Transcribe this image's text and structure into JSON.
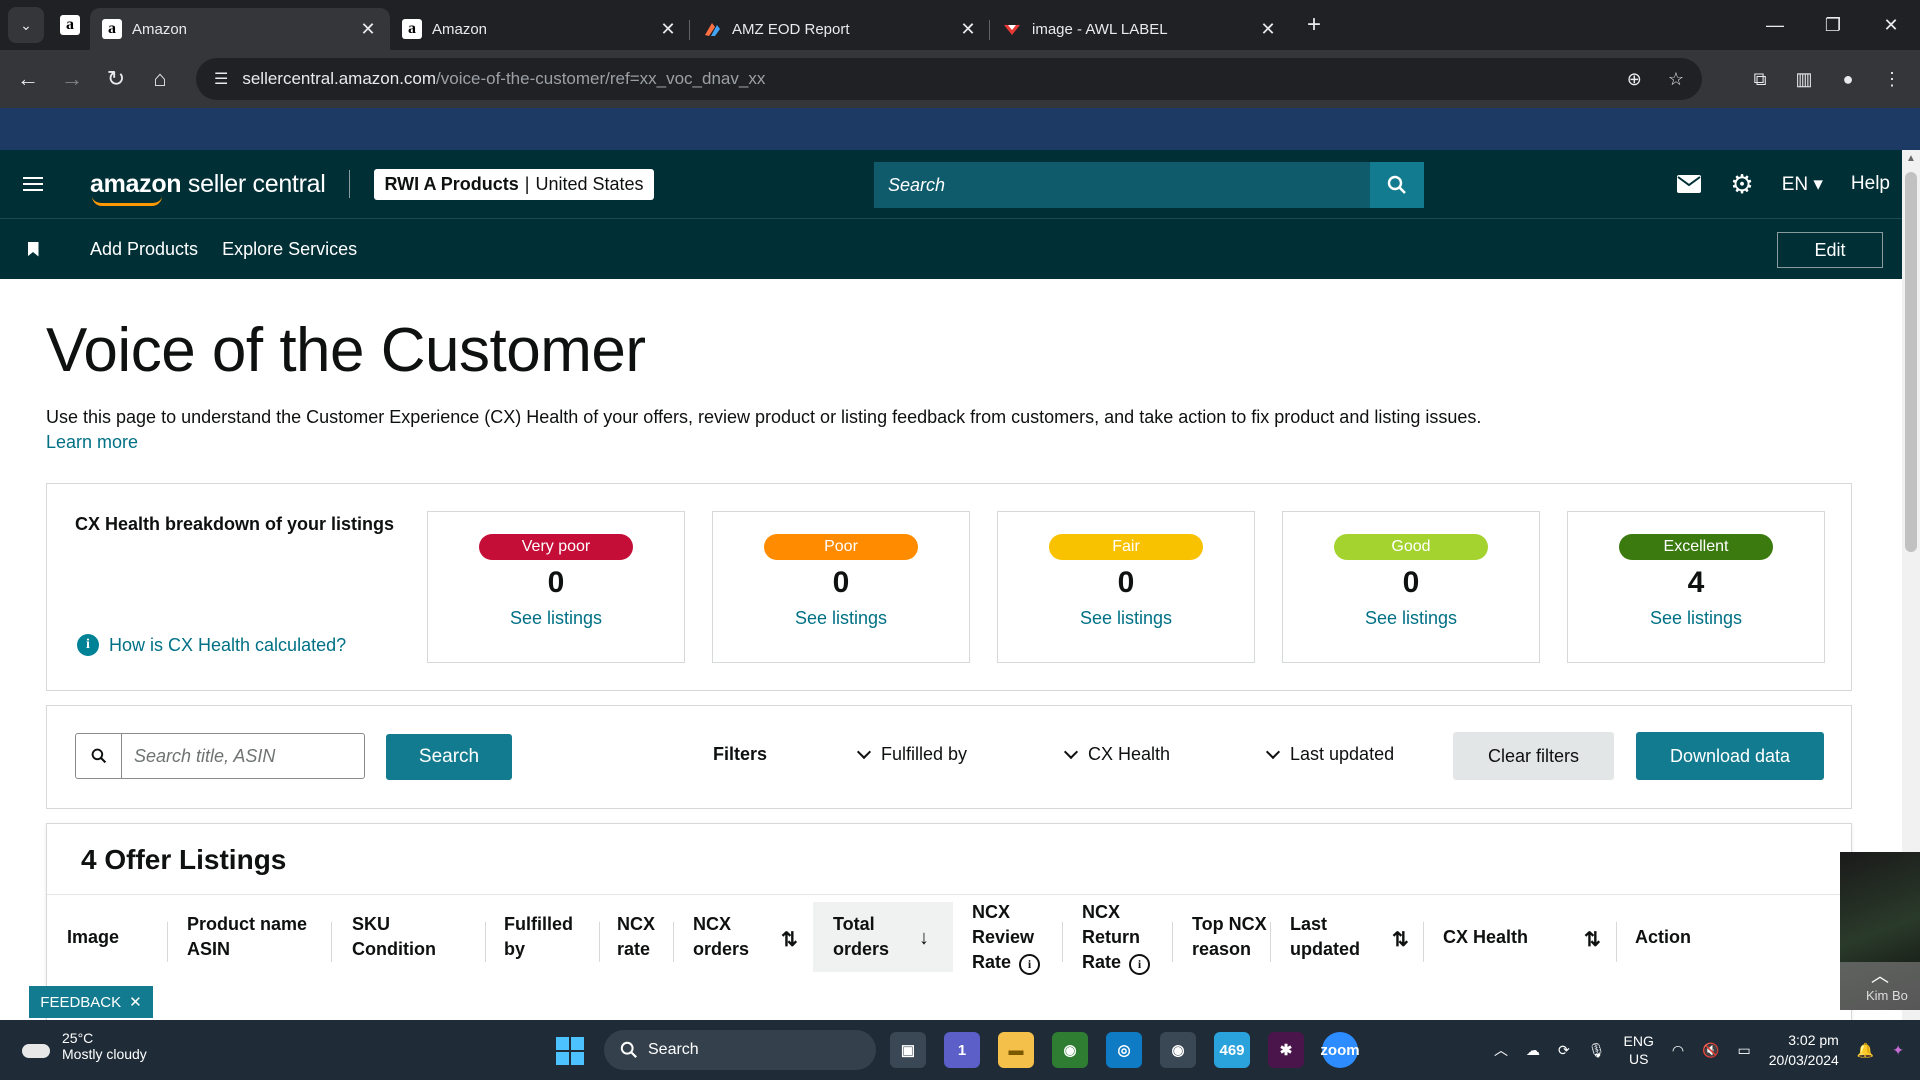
{
  "browser": {
    "tabs": [
      {
        "title": "Amazon",
        "active": true
      },
      {
        "title": "Amazon",
        "active": false
      },
      {
        "title": "AMZ EOD Report",
        "active": false
      },
      {
        "title": "image - AWL LABEL",
        "active": false
      }
    ],
    "url_host": "sellercentral.amazon.com",
    "url_path": "/voice-of-the-customer/ref=xx_voc_dnav_xx"
  },
  "header": {
    "logo_brand": "amazon",
    "logo_rest": " seller central",
    "account_name": "RWI A Products",
    "account_sep": "|",
    "account_region": "United States",
    "search_placeholder": "Search",
    "language": "EN",
    "help": "Help"
  },
  "subnav": {
    "items": [
      "Add Products",
      "Explore Services"
    ],
    "edit": "Edit"
  },
  "page": {
    "title": "Voice of the Customer",
    "intro": "Use this page to understand the Customer Experience (CX) Health of your offers, review product or listing feedback from customers, and take action to fix product and listing issues.",
    "learn_more": "Learn more"
  },
  "cx_health": {
    "title": "CX Health breakdown of your listings",
    "how_link": "How is CX Health calculated?",
    "cards": [
      {
        "label": "Very poor",
        "count": "0",
        "link": "See listings",
        "color": "#c40e38",
        "text": "#ffffff"
      },
      {
        "label": "Poor",
        "count": "0",
        "link": "See listings",
        "color": "#ff8c00",
        "text": "#ffffff"
      },
      {
        "label": "Fair",
        "count": "0",
        "link": "See listings",
        "color": "#f9c200",
        "text": "#ffffff"
      },
      {
        "label": "Good",
        "count": "0",
        "link": "See listings",
        "color": "#a4d32f",
        "text": "#ffffff"
      },
      {
        "label": "Excellent",
        "count": "4",
        "link": "See listings",
        "color": "#3b7a0f",
        "text": "#ffffff"
      }
    ]
  },
  "filters": {
    "search_placeholder": "Search title, ASIN",
    "search_button": "Search",
    "label": "Filters",
    "dropdowns": [
      "Fulfilled by",
      "CX Health",
      "Last updated"
    ],
    "clear": "Clear filters",
    "download": "Download data"
  },
  "listings": {
    "title": "4 Offer Listings",
    "columns": [
      {
        "l1": "Image",
        "l2": "",
        "l3": ""
      },
      {
        "l1": "Product name",
        "l2": "ASIN",
        "l3": ""
      },
      {
        "l1": "SKU",
        "l2": "Condition",
        "l3": ""
      },
      {
        "l1": "Fulfilled",
        "l2": "by",
        "l3": ""
      },
      {
        "l1": "NCX",
        "l2": "rate",
        "l3": ""
      },
      {
        "l1": "NCX",
        "l2": "orders",
        "l3": ""
      },
      {
        "l1": "Total",
        "l2": "orders",
        "l3": ""
      },
      {
        "l1": "NCX",
        "l2": "Review",
        "l3": "Rate"
      },
      {
        "l1": "NCX",
        "l2": "Return",
        "l3": "Rate"
      },
      {
        "l1": "Top NCX",
        "l2": "reason",
        "l3": ""
      },
      {
        "l1": "Last",
        "l2": "updated",
        "l3": ""
      },
      {
        "l1": "CX Health",
        "l2": "",
        "l3": ""
      },
      {
        "l1": "Action",
        "l2": "",
        "l3": ""
      }
    ]
  },
  "feedback": "FEEDBACK",
  "video_caption": "Kim Bo",
  "taskbar": {
    "temp": "25°C",
    "weather": "Mostly cloudy",
    "search": "Search",
    "badge_teams": "1",
    "badge_telegram": "469",
    "zoom": "zoom",
    "lang1": "ENG",
    "lang2": "US",
    "time": "3:02 pm",
    "date": "20/03/2024"
  }
}
